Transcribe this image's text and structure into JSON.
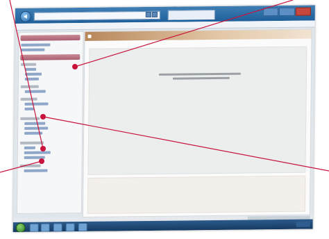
{
  "window": {
    "address_url": "",
    "tab_title": "",
    "buttons": [
      "minimize",
      "maximize",
      "close"
    ]
  },
  "menu": [
    "",
    "",
    "",
    "",
    "",
    ""
  ],
  "sidebar": {
    "header_1": "",
    "header_2": "",
    "icon_names": [
      "sidebar-section-icon"
    ]
  },
  "main": {
    "header_title": "",
    "message_line_1": "",
    "message_line_2": ""
  },
  "taskbar": {
    "icons": [
      "start-orb-icon",
      "ie-icon",
      "folder-icon",
      "media-icon",
      "explorer-icon",
      "app-icon"
    ],
    "clock": ""
  },
  "callouts": {
    "color": "#c8143c",
    "count": 4
  }
}
